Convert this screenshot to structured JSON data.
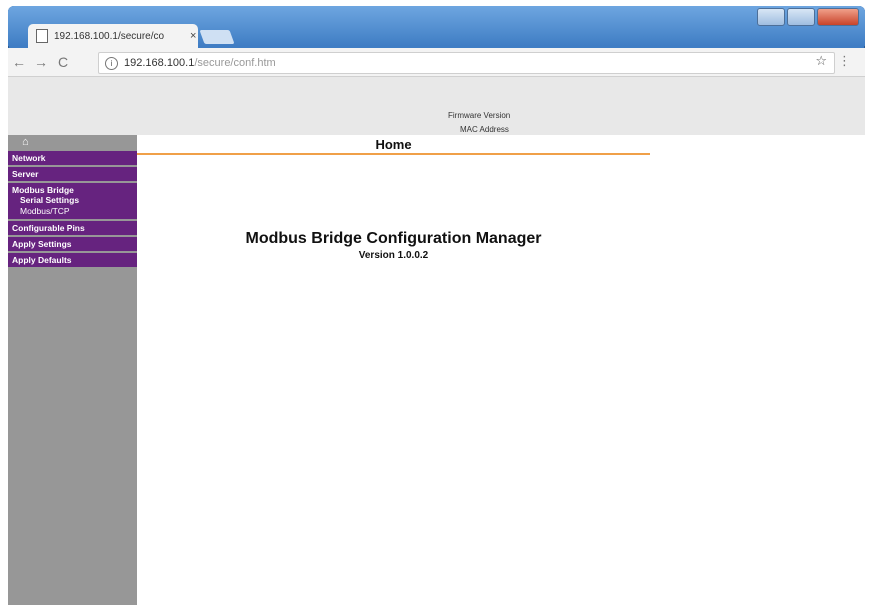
{
  "browser": {
    "tab_title": "192.168.100.1/secure/co",
    "tab_close": "×",
    "url_host": "192.168.100.1",
    "url_path": "/secure/conf.htm",
    "back": "←",
    "forward": "→",
    "reload": "C",
    "info_icon": "i",
    "star_icon": "☆",
    "menu_icon": "⋮"
  },
  "header": {
    "firmware_version": "Firmware Version",
    "mac_address": "MAC Address"
  },
  "sidebar": {
    "home_icon": "⌂",
    "items": [
      {
        "label": "Network"
      },
      {
        "label": "Server"
      },
      {
        "label": "Modbus Bridge"
      },
      {
        "label": "Serial Settings"
      },
      {
        "label": "Modbus/TCP"
      },
      {
        "label": "Configurable Pins"
      },
      {
        "label": "Apply Settings"
      },
      {
        "label": "Apply Defaults"
      }
    ]
  },
  "main": {
    "section_title": "Home",
    "title": "Modbus Bridge Configuration Manager",
    "version": "Version 1.0.0.2"
  }
}
